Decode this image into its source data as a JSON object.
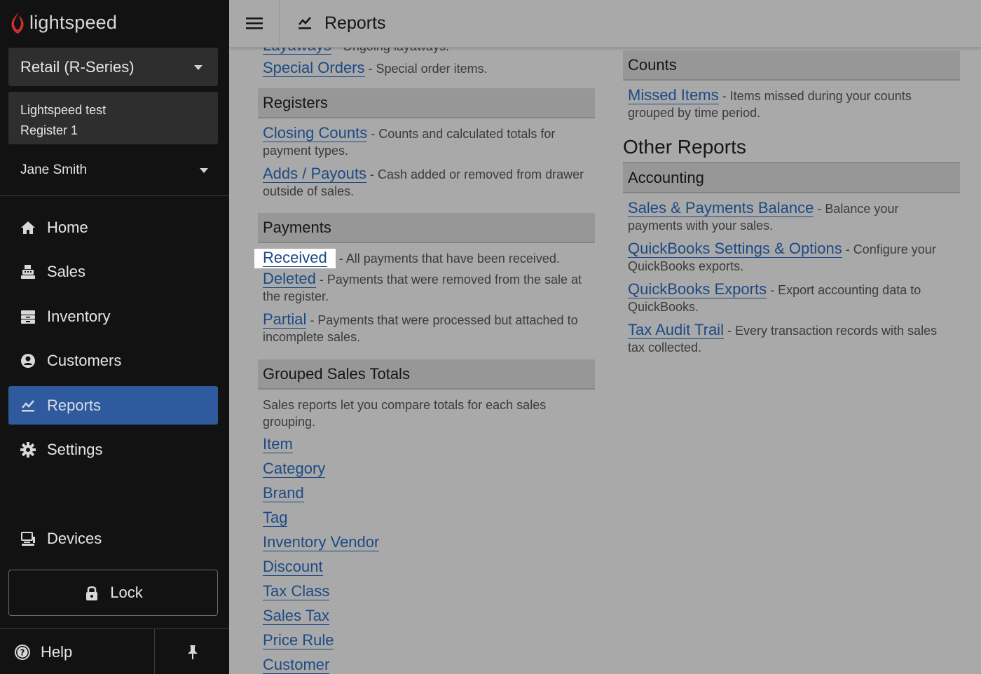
{
  "brand": {
    "name": "lightspeed"
  },
  "sidebar": {
    "product": "Retail (R-Series)",
    "register_line1": "Lightspeed test",
    "register_line2": "Register 1",
    "user": "Jane Smith",
    "items": [
      {
        "label": "Home",
        "icon": "home-icon"
      },
      {
        "label": "Sales",
        "icon": "register-icon"
      },
      {
        "label": "Inventory",
        "icon": "inventory-icon"
      },
      {
        "label": "Customers",
        "icon": "customer-icon"
      },
      {
        "label": "Reports",
        "icon": "reports-icon",
        "active": true
      },
      {
        "label": "Settings",
        "icon": "gear-icon"
      },
      {
        "label": "Devices",
        "icon": "devices-icon"
      }
    ],
    "lock": "Lock",
    "help": "Help"
  },
  "header": {
    "title": "Reports"
  },
  "left": {
    "top_partial_link": "Layaways",
    "top_partial_desc": "- Ongoing layaways.",
    "special_orders": {
      "link": "Special Orders",
      "desc": "- Special order items."
    },
    "registers": {
      "title": "Registers",
      "entries": [
        {
          "link": "Closing Counts",
          "desc": "- Counts and calculated totals for payment types."
        },
        {
          "link": "Adds / Payouts",
          "desc": "- Cash added or removed from drawer outside of sales."
        }
      ]
    },
    "payments": {
      "title": "Payments",
      "entries": [
        {
          "link": "Received",
          "desc": "- All payments that have been received."
        },
        {
          "link": "Deleted",
          "desc": "- Payments that were removed from the sale at the register."
        },
        {
          "link": "Partial",
          "desc": "- Payments that were processed but attached to incomplete sales."
        }
      ]
    },
    "grouped": {
      "title": "Grouped Sales Totals",
      "intro": "Sales reports let you compare totals for each sales grouping.",
      "links": [
        "Item",
        "Category",
        "Brand",
        "Tag",
        "Inventory Vendor",
        "Discount",
        "Tax Class",
        "Sales Tax",
        "Price Rule"
      ],
      "cut_link": "Customer"
    }
  },
  "right": {
    "counts": {
      "title": "Counts",
      "entries": [
        {
          "link": "Missed Items",
          "desc": "- Items missed during your counts grouped by time period."
        }
      ]
    },
    "other_title": "Other Reports",
    "accounting": {
      "title": "Accounting",
      "entries": [
        {
          "link": "Sales & Payments Balance",
          "desc": "- Balance your payments with your sales."
        },
        {
          "link": "QuickBooks Settings & Options",
          "desc": "- Configure your QuickBooks exports."
        },
        {
          "link": "QuickBooks Exports",
          "desc": "- Export accounting data to QuickBooks."
        },
        {
          "link": "Tax Audit Trail",
          "desc": "- Every transaction records with sales tax collected."
        }
      ]
    }
  },
  "colors": {
    "sidebar_bg": "#121212",
    "active_nav": "#2f5a9e",
    "link": "#1c4a86",
    "brand_red": "#d8322b"
  }
}
